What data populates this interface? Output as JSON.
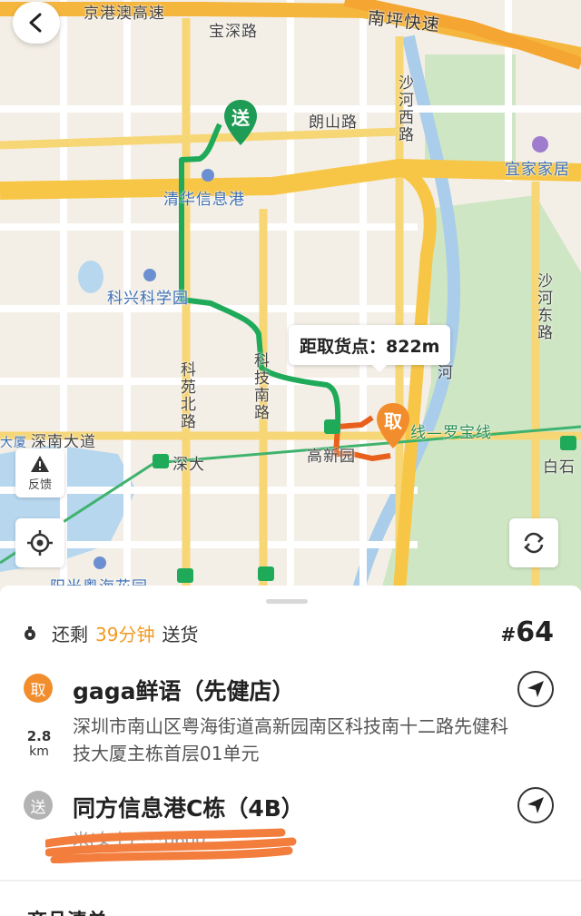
{
  "map": {
    "roads": {
      "expressway_top": "京港澳高速",
      "baoshen": "宝深路",
      "nanping": "南坪快速",
      "langshan": "朗山路",
      "shahe_west": "沙河西路",
      "yijia": "宜家家居",
      "qinghua": "清华信息港",
      "kexing": "科兴科学园",
      "shahe_east": "沙河东路",
      "keyuan_north": "科苑北路",
      "keji_south": "科技南路",
      "shennan": "深南大道",
      "shenda": "深大",
      "gaoxinyuan": "高新园",
      "luobao_line": "线—罗宝线",
      "baishi": "白石",
      "river": "河",
      "yangguang": "阳光粤海花园",
      "dasha": "大厦"
    },
    "callout": "距取货点：822m",
    "pin_send": "送",
    "pin_pick": "取",
    "feedback_label": "反馈",
    "colors": {
      "route_green": "#1faa5a",
      "route_orange": "#e8601c",
      "pick": "#f28d2d",
      "send_pin": "#1e9b55"
    }
  },
  "sheet": {
    "timer_prefix": "还剩",
    "timer_value": "39分钟",
    "timer_suffix": "送货",
    "order_hash": "#",
    "order_number": "64",
    "pickup": {
      "badge": "取",
      "name": "gaga鲜语（先健店）",
      "address": "深圳市南山区粤海街道高新园南区科技南十二路先健科技大厦主栋首层01单元",
      "distance": "2.8",
      "distance_unit": "km"
    },
    "delivery": {
      "badge": "送",
      "name": "同方信息港C栋（4B）",
      "phone": "米(女士)  ***0600"
    },
    "footer_text": "商品清单"
  },
  "icons": {
    "back": "chevron-left-icon",
    "feedback": "warning-icon",
    "locate": "locate-icon",
    "refresh": "refresh-icon",
    "navigate": "navigation-arrow-icon",
    "timer": "timer-dot-icon"
  }
}
